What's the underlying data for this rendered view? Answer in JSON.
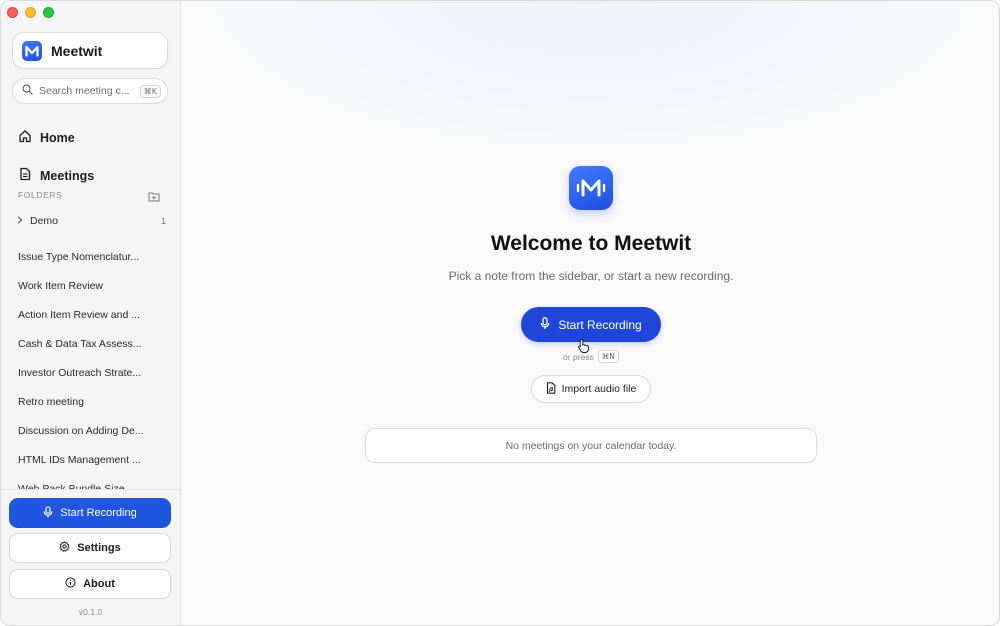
{
  "window": {
    "controls": [
      "close",
      "minimize",
      "zoom"
    ]
  },
  "sidebar": {
    "brand": {
      "name": "Meetwit",
      "icon": "meetwit-logo-icon"
    },
    "search": {
      "placeholder": "Search meeting c...",
      "shortcut": "⌘K",
      "icon": "search-icon"
    },
    "nav": [
      {
        "label": "Home",
        "icon": "home-icon"
      },
      {
        "label": "Meetings",
        "icon": "document-icon"
      }
    ],
    "folders_label": "FOLDERS",
    "folders": [
      {
        "label": "Demo",
        "count": "1"
      }
    ],
    "meetings": [
      "Issue Type Nomenclatur...",
      "Work Item Review",
      "Action Item Review and ...",
      "Cash & Data Tax Assess...",
      "Investor Outreach Strate...",
      "Retro meeting",
      "Discussion on Adding De...",
      "HTML IDs Management ...",
      "Web Pack Bundle Size..."
    ],
    "start_recording_label": "Start Recording",
    "settings_label": "Settings",
    "about_label": "About",
    "version": "v0.1.0"
  },
  "main": {
    "title": "Welcome to Meetwit",
    "subtitle": "Pick a note from the sidebar, or start a new recording.",
    "start_recording_label": "Start Recording",
    "or_press_label": "or press",
    "shortcut": "⌘N",
    "import_label": "Import audio file",
    "calendar_empty": "No meetings on your calendar today."
  },
  "colors": {
    "accent": "#1f56e0",
    "main_button": "#1f46d9",
    "sidebar_bg": "#f5f5f5"
  }
}
